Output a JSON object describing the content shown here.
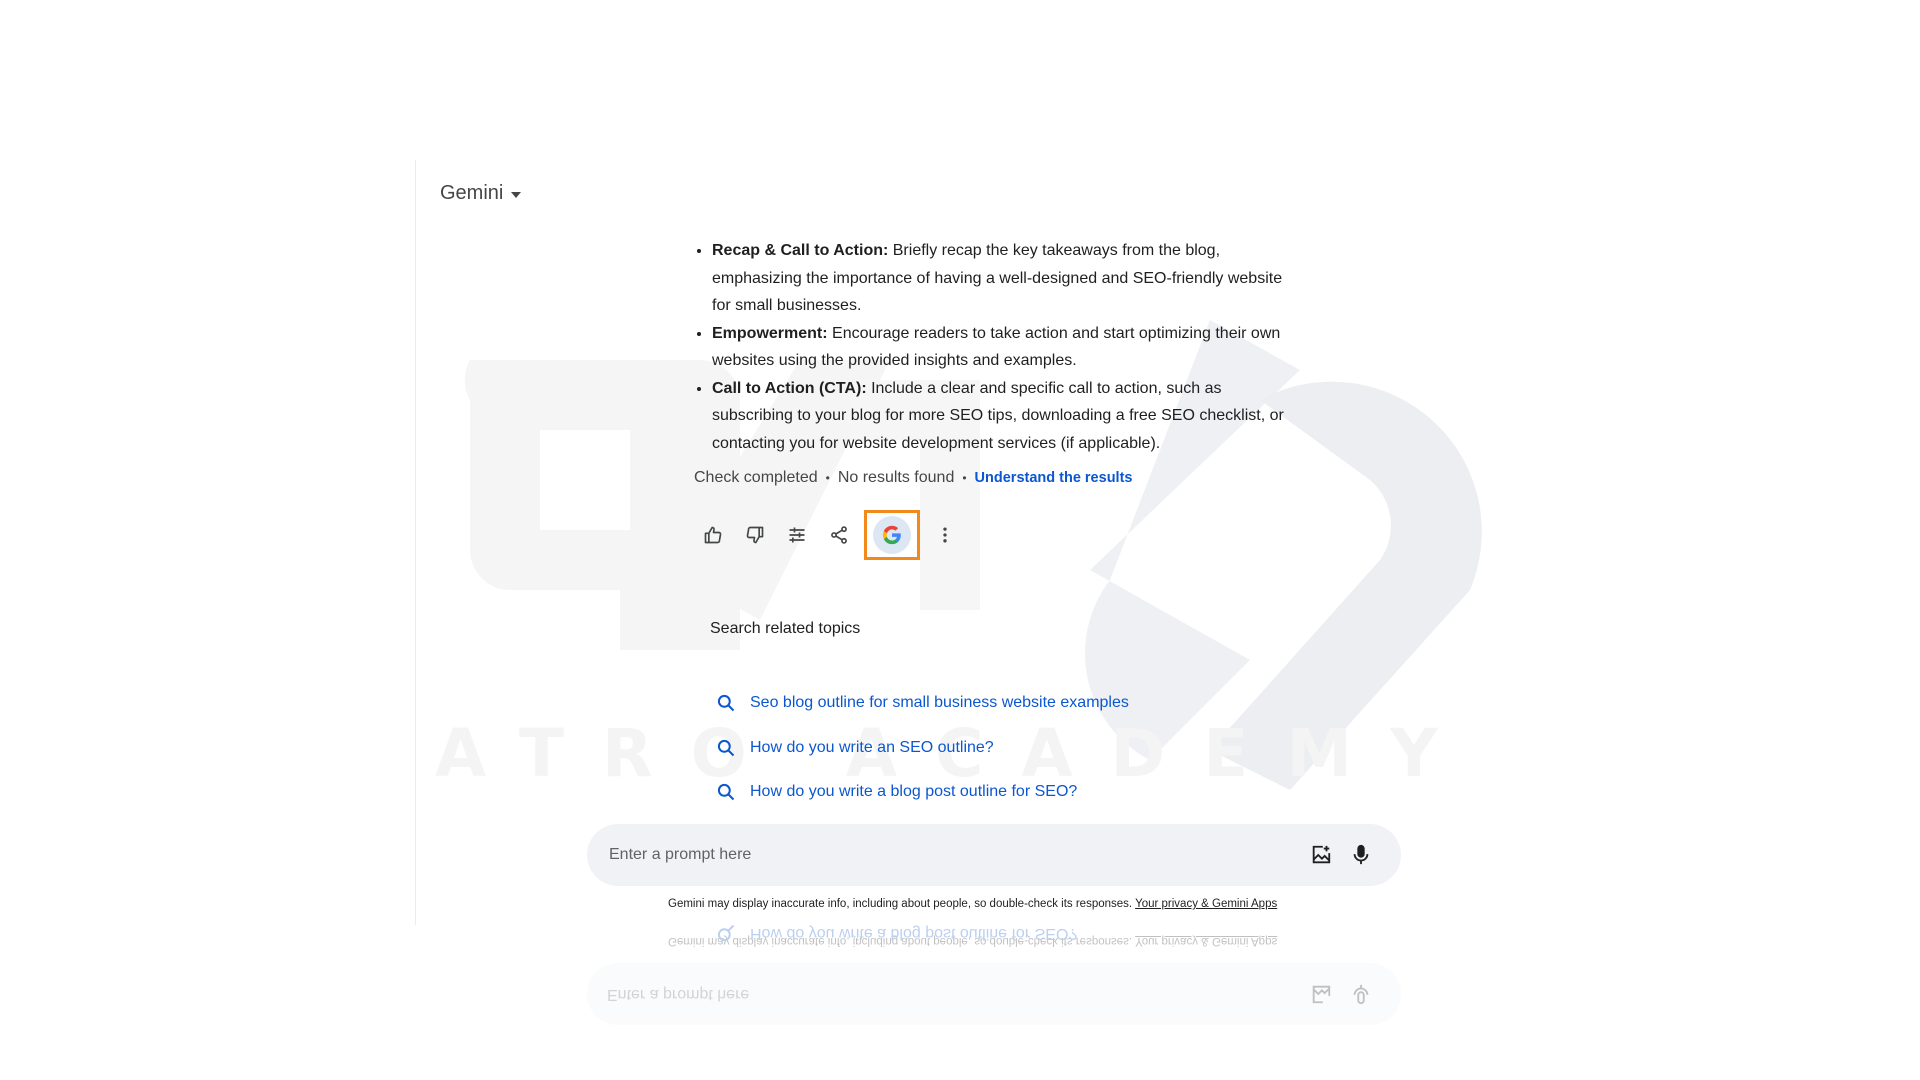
{
  "header": {
    "model_name": "Gemini"
  },
  "watermark": {
    "text": "ATRO ACADEMY"
  },
  "response": {
    "bullets": [
      {
        "title": "Recap & Call to Action:",
        "text": " Briefly recap the key takeaways from the blog, emphasizing the importance of having a well-designed and SEO-friendly website for small businesses."
      },
      {
        "title": "Empowerment:",
        "text": " Encourage readers to take action and start optimizing their own websites using the provided insights and examples."
      },
      {
        "title": "Call to Action (CTA):",
        "text": " Include a clear and specific call to action, such as subscribing to your blog for more SEO tips, downloading a free SEO checklist, or contacting you for website development services (if applicable)."
      }
    ],
    "check_status": "Check completed",
    "separator": "•",
    "results_status": "No results found",
    "understand_link": "Understand the results"
  },
  "actions": {
    "icons": [
      "thumbs-up-icon",
      "thumbs-down-icon",
      "modify-icon",
      "share-icon",
      "google-check-icon",
      "more-vert-icon"
    ],
    "google_letter": "G",
    "highlight_color": "#f28a1b"
  },
  "related": {
    "title": "Search related topics",
    "items": [
      "Seo blog outline for small business website examples",
      "How do you write an SEO outline?",
      "How do you write a blog post outline for SEO?"
    ]
  },
  "prompt": {
    "placeholder": "Enter a prompt here"
  },
  "footer": {
    "disclaimer": "Gemini may display inaccurate info, including about people, so double-check its responses.",
    "privacy_link": "Your privacy & Gemini Apps"
  },
  "colors": {
    "link": "#0b57d0",
    "prompt_bg": "#f0f2f6",
    "text": "#1f1f1f"
  }
}
